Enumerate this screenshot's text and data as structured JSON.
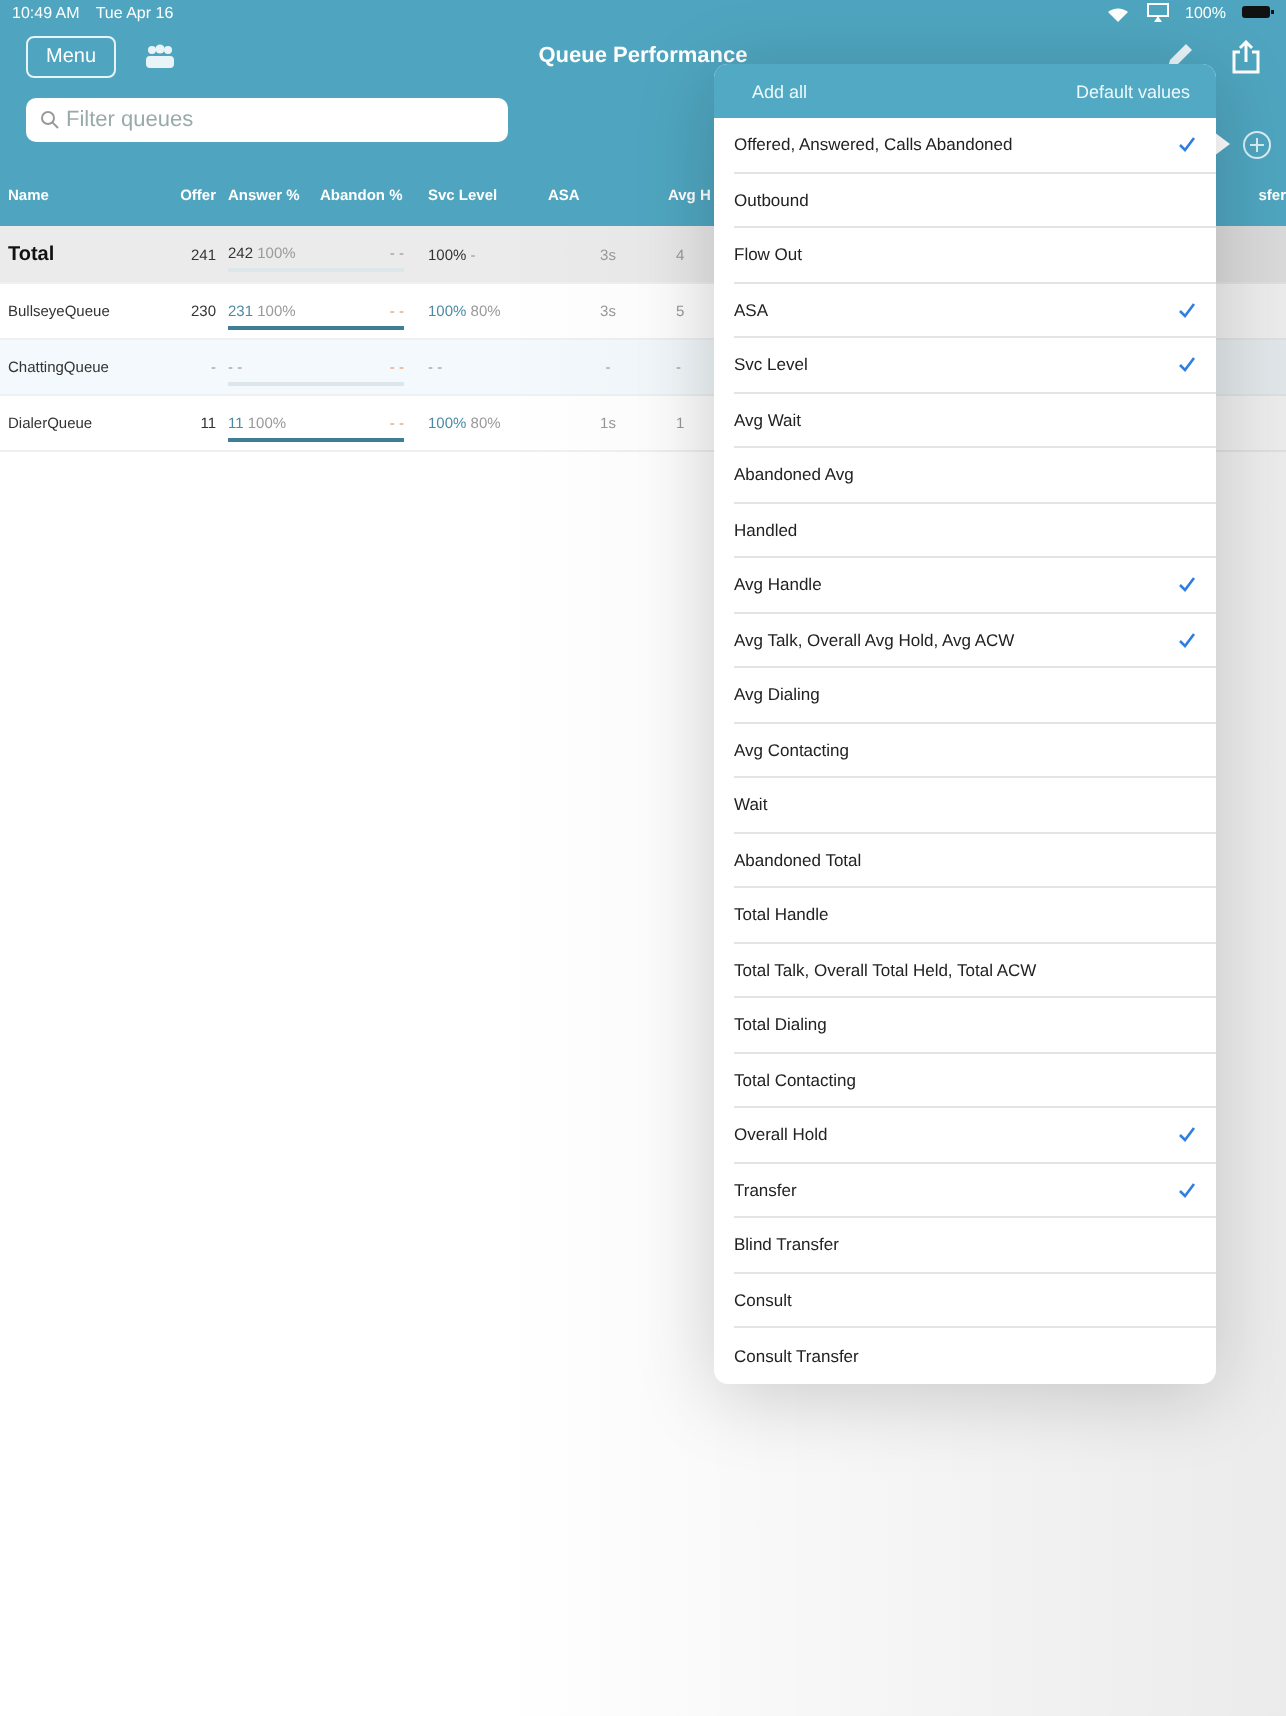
{
  "status_bar": {
    "time": "10:49 AM",
    "date": "Tue Apr 16",
    "battery": "100%"
  },
  "nav": {
    "menu_button": "Menu",
    "title": "Queue Performance"
  },
  "search": {
    "placeholder": "Filter queues"
  },
  "table": {
    "columns": [
      "Name",
      "Offer",
      "Answer %",
      "Abandon %",
      "Svc Level",
      "ASA",
      "Avg H"
    ],
    "column_cut_right": "sfer",
    "rows": [
      {
        "kind": "total",
        "name": "Total",
        "offer": "241",
        "answer": "242",
        "answer_pct": "100%",
        "abandon": "- -",
        "svc": "100%",
        "svc_target": "-",
        "asa": "3s",
        "avg": "4"
      },
      {
        "kind": "queue",
        "name": "BullseyeQueue",
        "offer": "230",
        "answer": "231",
        "answer_pct": "100%",
        "abandon": "- -",
        "svc": "100%",
        "svc_target": "80%",
        "asa": "3s",
        "avg": "5",
        "level": 1
      },
      {
        "kind": "queue",
        "name": "ChattingQueue",
        "offer": "-",
        "answer": "- -",
        "abandon": "- -",
        "svc": "- -",
        "asa": "-",
        "avg": "-",
        "selected": true
      },
      {
        "kind": "queue",
        "name": "DialerQueue",
        "offer": "11",
        "answer": "11",
        "answer_pct": "100%",
        "abandon": "- -",
        "svc": "100%",
        "svc_target": "80%",
        "asa": "1s",
        "avg": "1",
        "level": 1
      }
    ]
  },
  "popover": {
    "add_all": "Add all",
    "default_values": "Default values",
    "items": [
      {
        "label": "Offered, Answered, Calls Abandoned",
        "checked": true
      },
      {
        "label": "Outbound",
        "checked": false
      },
      {
        "label": "Flow Out",
        "checked": false
      },
      {
        "label": "ASA",
        "checked": true
      },
      {
        "label": "Svc Level",
        "checked": true
      },
      {
        "label": "Avg Wait",
        "checked": false
      },
      {
        "label": "Abandoned Avg",
        "checked": false
      },
      {
        "label": "Handled",
        "checked": false
      },
      {
        "label": "Avg Handle",
        "checked": true
      },
      {
        "label": "Avg Talk, Overall Avg Hold, Avg ACW",
        "checked": true
      },
      {
        "label": "Avg Dialing",
        "checked": false
      },
      {
        "label": "Avg Contacting",
        "checked": false
      },
      {
        "label": "Wait",
        "checked": false
      },
      {
        "label": "Abandoned Total",
        "checked": false
      },
      {
        "label": "Total Handle",
        "checked": false
      },
      {
        "label": "Total Talk, Overall Total Held, Total ACW",
        "checked": false
      },
      {
        "label": "Total Dialing",
        "checked": false
      },
      {
        "label": "Total Contacting",
        "checked": false
      },
      {
        "label": "Overall Hold",
        "checked": true
      },
      {
        "label": "Transfer",
        "checked": true
      },
      {
        "label": "Blind Transfer",
        "checked": false
      },
      {
        "label": "Consult",
        "checked": false
      },
      {
        "label": "Consult Transfer",
        "checked": false
      }
    ]
  }
}
